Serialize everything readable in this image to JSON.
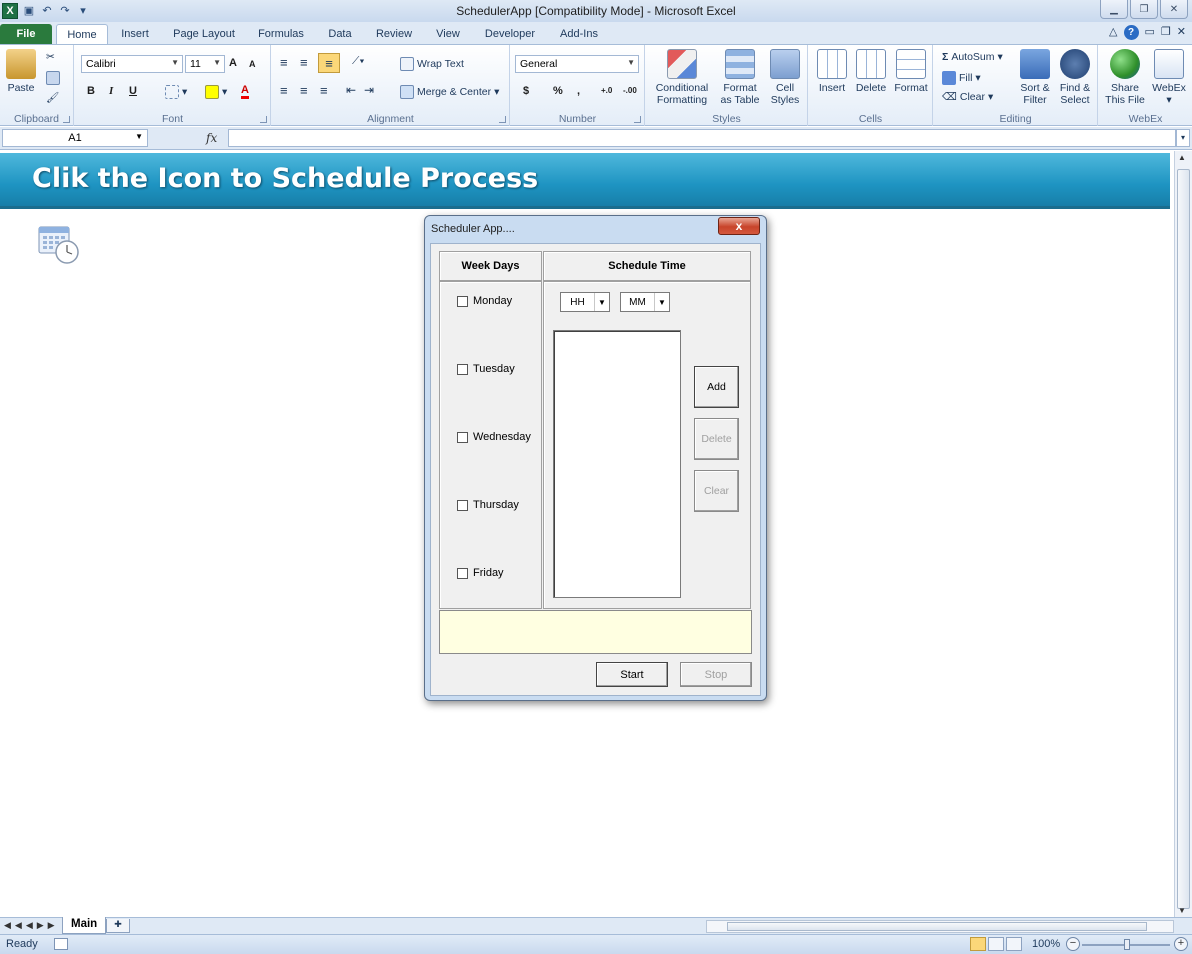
{
  "window": {
    "title": "SchedulerApp  [Compatibility Mode]  -  Microsoft Excel",
    "app_icon": "X"
  },
  "ribbon": {
    "tabs": [
      "File",
      "Home",
      "Insert",
      "Page Layout",
      "Formulas",
      "Data",
      "Review",
      "View",
      "Developer",
      "Add-Ins"
    ],
    "clipboard": {
      "paste": "Paste",
      "label": "Clipboard"
    },
    "font": {
      "name": "Calibri",
      "size": "11",
      "label": "Font",
      "bold": "B",
      "italic": "I",
      "underline": "U",
      "grow": "A",
      "shrink": "A",
      "color": "A"
    },
    "alignment": {
      "wrap": "Wrap Text",
      "merge": "Merge & Center",
      "label": "Alignment"
    },
    "number": {
      "format": "General",
      "currency": "$",
      "percent": "%",
      "comma": ",",
      "inc": "+.0",
      "dec": "-.00",
      "label": "Number"
    },
    "styles": {
      "conditional": [
        "Conditional",
        "Formatting"
      ],
      "table": [
        "Format",
        "as Table"
      ],
      "cell": [
        "Cell",
        "Styles"
      ],
      "label": "Styles"
    },
    "cells": {
      "insert": "Insert",
      "delete": "Delete",
      "format": "Format",
      "label": "Cells"
    },
    "editing": {
      "autosum": "AutoSum",
      "fill": "Fill",
      "clear": "Clear",
      "sort": [
        "Sort &",
        "Filter"
      ],
      "find": [
        "Find &",
        "Select"
      ],
      "label": "Editing"
    },
    "webex": {
      "share": [
        "Share",
        "This File"
      ],
      "webex": "WebEx",
      "label": "WebEx"
    }
  },
  "formula_bar": {
    "name_box": "A1",
    "fx": "fx",
    "value": ""
  },
  "sheet": {
    "banner": "Clik the Icon to Schedule Process",
    "tabs": [
      "Main"
    ]
  },
  "status_bar": {
    "ready": "Ready",
    "zoom": "100%"
  },
  "dialog": {
    "title": "Scheduler App....",
    "close": "x",
    "headers": {
      "days": "Week Days",
      "time": "Schedule Time"
    },
    "days": [
      "Monday",
      "Tuesday",
      "Wednesday",
      "Thursday",
      "Friday"
    ],
    "hour": "HH",
    "minute": "MM",
    "buttons": {
      "add": "Add",
      "delete": "Delete",
      "clear": "Clear",
      "start": "Start",
      "stop": "Stop"
    }
  },
  "colors": {
    "banner": "#1e94c2",
    "file_tab": "#2a7a3d",
    "status_box": "#ffffe1",
    "close_button": "#c8442b"
  }
}
